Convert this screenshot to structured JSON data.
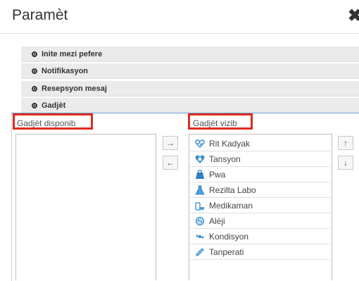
{
  "modal": {
    "title": "Paramèt",
    "close_glyph": "✖"
  },
  "accordion": [
    {
      "label": "Inite mezi pefere"
    },
    {
      "label": "Notifikasyon"
    },
    {
      "label": "Resepsyon mesaj"
    },
    {
      "label": "Gadjèt"
    }
  ],
  "available": {
    "label": "Gadjèt disponib"
  },
  "visible": {
    "label": "Gadjèt vizib",
    "items": [
      {
        "label": "Rit Kadyak",
        "icon": "heart-rate-icon"
      },
      {
        "label": "Tansyon",
        "icon": "blood-pressure-icon"
      },
      {
        "label": "Pwa",
        "icon": "weight-scale-icon"
      },
      {
        "label": "Rezilta Labo",
        "icon": "lab-flask-icon"
      },
      {
        "label": "Medikaman",
        "icon": "medication-icon"
      },
      {
        "label": "Alèji",
        "icon": "allergy-icon"
      },
      {
        "label": "Kondisyon",
        "icon": "condition-icon"
      },
      {
        "label": "Tanperati",
        "icon": "thermometer-icon"
      }
    ]
  },
  "transfer": {
    "add": "→",
    "remove": "←"
  },
  "order": {
    "up": "↑",
    "down": "↓"
  },
  "colors": {
    "highlight": "#e02a1f",
    "active_border": "#6d9ec7"
  }
}
